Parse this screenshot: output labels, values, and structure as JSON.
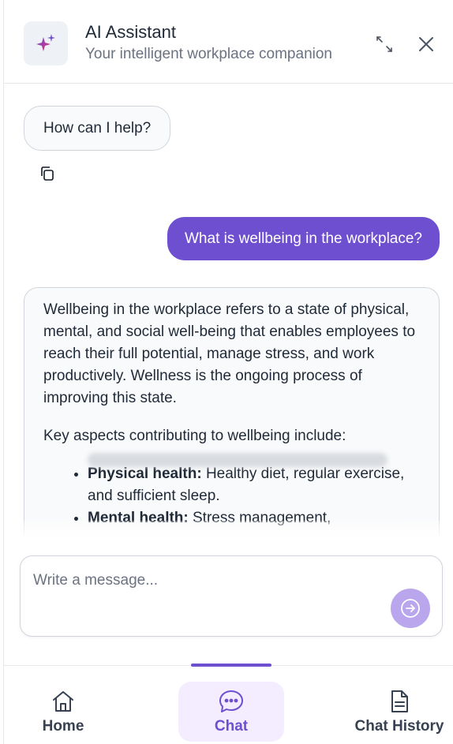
{
  "header": {
    "title": "AI Assistant",
    "subtitle": "Your intelligent workplace companion",
    "icons": {
      "logo": "sparkles-icon",
      "expand": "expand-icon",
      "close": "close-icon"
    }
  },
  "chat": {
    "messages": [
      {
        "role": "assistant",
        "text": "How can I help?"
      },
      {
        "role": "user",
        "text": "What is wellbeing in the workplace?"
      },
      {
        "role": "assistant",
        "paragraph1": "Wellbeing in the workplace refers to a state of physical, mental, and social well-being that enables employees to reach their full potential, manage stress, and work productively. Wellness is the ongoing process of improving this state.",
        "paragraph2": "Key aspects contributing to wellbeing include:",
        "bullets": [
          {
            "label": "Physical health:",
            "text": " Healthy diet, regular exercise, and sufficient sleep."
          },
          {
            "label": "Mental health:",
            "text": " Stress management,"
          }
        ]
      }
    ],
    "copy_icon": "copy-icon"
  },
  "composer": {
    "placeholder": "Write a message...",
    "value": "",
    "send_icon": "send-arrow-icon"
  },
  "nav": {
    "items": [
      {
        "label": "Home",
        "icon": "home-icon"
      },
      {
        "label": "Chat",
        "icon": "chat-bubble-icon",
        "active": true
      },
      {
        "label": "Chat History",
        "icon": "document-icon"
      }
    ]
  },
  "colors": {
    "accent": "#6d4fcf",
    "send_button": "#b9a6ec",
    "active_tab_bg": "#f3edff",
    "bubble_border": "#d1d5db"
  }
}
